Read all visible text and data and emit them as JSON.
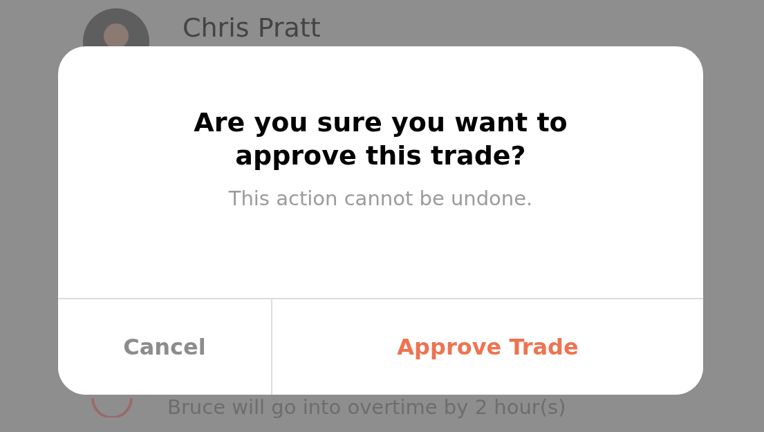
{
  "background": {
    "contact": {
      "name": "Chris Pratt"
    },
    "notice": {
      "text": "Bruce will go into overtime by 2 hour(s)"
    }
  },
  "dialog": {
    "title": "Are you sure you want to approve this trade?",
    "message": "This action cannot be undone.",
    "buttons": [
      {
        "label": "Cancel",
        "kind": "cancel"
      },
      {
        "label": "Approve Trade",
        "kind": "confirm"
      }
    ]
  }
}
